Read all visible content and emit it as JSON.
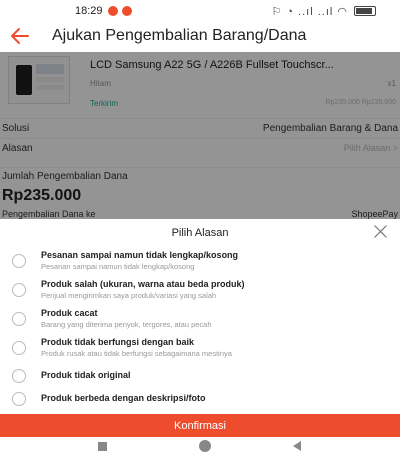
{
  "status_bar": {
    "time": "18:29",
    "icons_text": "⚐ ◔ ..ıl ..ıl ◠"
  },
  "header": {
    "title": "Ajukan Pengembalian Barang/Dana"
  },
  "product": {
    "name": "LCD Samsung A22 5G / A226B Fullset Touchscr...",
    "variant": "Hitam",
    "quantity": "x1",
    "shipping_status": "Terkirim",
    "price_text": "Rp235.000 Rp235.000"
  },
  "form": {
    "solution_label": "Solusi",
    "solution_value": "Pengembalian Barang & Dana",
    "reason_label": "Alasan",
    "reason_placeholder": "Pilih Alasan  >",
    "refund_label": "Jumlah Pengembalian Dana",
    "refund_amount": "Rp235.000",
    "refund_to_label": "Pengembalian Dana ke",
    "refund_to_value": "ShopeePay"
  },
  "sheet": {
    "title": "Pilih Alasan",
    "options": [
      {
        "label": "Pesanan sampai namun tidak lengkap/kosong",
        "description": "Pesanan sampai namun tidak lengkap/kosong"
      },
      {
        "label": "Produk salah (ukuran, warna atau beda produk)",
        "description": "Penjual mengirimkan saya produk/variasi yang salah"
      },
      {
        "label": "Produk cacat",
        "description": "Barang yang diterima penyok, tergores, atau pecah"
      },
      {
        "label": "Produk tidak berfungsi dengan baik",
        "description": "Produk rusak atau tidak berfungsi sebagaimana mestinya"
      },
      {
        "label": "Produk tidak original",
        "description": ""
      },
      {
        "label": "Produk berbeda dengan deskripsi/foto",
        "description": ""
      }
    ],
    "confirm_label": "Konfirmasi"
  },
  "colors": {
    "accent": "#ee4d2d",
    "shipped": "#26aa99"
  }
}
